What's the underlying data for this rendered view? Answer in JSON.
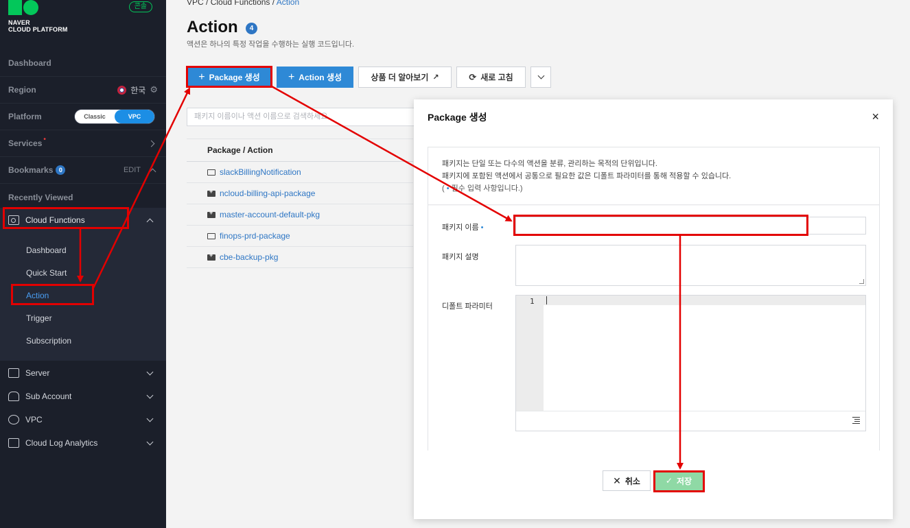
{
  "brand": {
    "line1": "NAVER",
    "line2": "CLOUD PLATFORM",
    "console_badge": "콘솔",
    "color": "#03c75a"
  },
  "sidebar": {
    "dashboard": "Dashboard",
    "region_label": "Region",
    "region_value": "한국",
    "platform_label": "Platform",
    "platform_options": [
      "Classic",
      "VPC"
    ],
    "platform_selected": "VPC",
    "services_label": "Services",
    "services_mark": "•",
    "bookmarks_label": "Bookmarks",
    "bookmarks_count": "0",
    "bookmarks_edit": "EDIT",
    "recently_viewed": "Recently Viewed",
    "open_service": {
      "label": "Cloud Functions",
      "items": [
        "Dashboard",
        "Quick Start",
        "Action",
        "Trigger",
        "Subscription"
      ],
      "active": "Action"
    },
    "services": [
      "Server",
      "Sub Account",
      "VPC",
      "Cloud Log Analytics"
    ]
  },
  "main": {
    "breadcrumb": [
      "VPC",
      "Cloud Functions",
      "Action"
    ],
    "breadcrumb_sep": "/",
    "title": "Action",
    "title_count": "4",
    "description": "액션은 하나의 특정 작업을 수행하는 실행 코드입니다.",
    "toolbar": {
      "package_create": "Package 생성",
      "action_create": "Action 생성",
      "learn_more": "상품 더 알아보기",
      "refresh": "새로 고침"
    },
    "search_placeholder": "패키지 이름이나 액션 이름으로 검색하세요.",
    "list_header": "Package / Action",
    "list": [
      {
        "name": "slackBillingNotification",
        "type": "folder"
      },
      {
        "name": "ncloud-billing-api-package",
        "type": "package"
      },
      {
        "name": "master-account-default-pkg",
        "type": "package"
      },
      {
        "name": "finops-prd-package",
        "type": "folder"
      },
      {
        "name": "cbe-backup-pkg",
        "type": "package"
      }
    ]
  },
  "modal": {
    "title": "Package 생성",
    "close": "×",
    "info_line1": "패키지는 단일 또는 다수의 액션을 분류, 관리하는 목적의 단위입니다.",
    "info_line2": "패키지에 포함된 액션에서 공통으로 필요한 값은 디폴트 파라미터를 통해 적용할 수 있습니다.",
    "required_open": "(",
    "required_note": "필수 입력 사항입니다.)",
    "required_mark": "•",
    "fields": {
      "name_label": "패키지 이름",
      "desc_label": "패키지 설명",
      "params_label": "디폴트 파라미터"
    },
    "editor_line": "1",
    "cancel": "취소",
    "save": "저장"
  },
  "colors": {
    "accent": "#2e89d6",
    "sidebar_bg": "#1b1f2a",
    "save_disabled": "#8fd9a5",
    "annotation": "#e30000"
  }
}
